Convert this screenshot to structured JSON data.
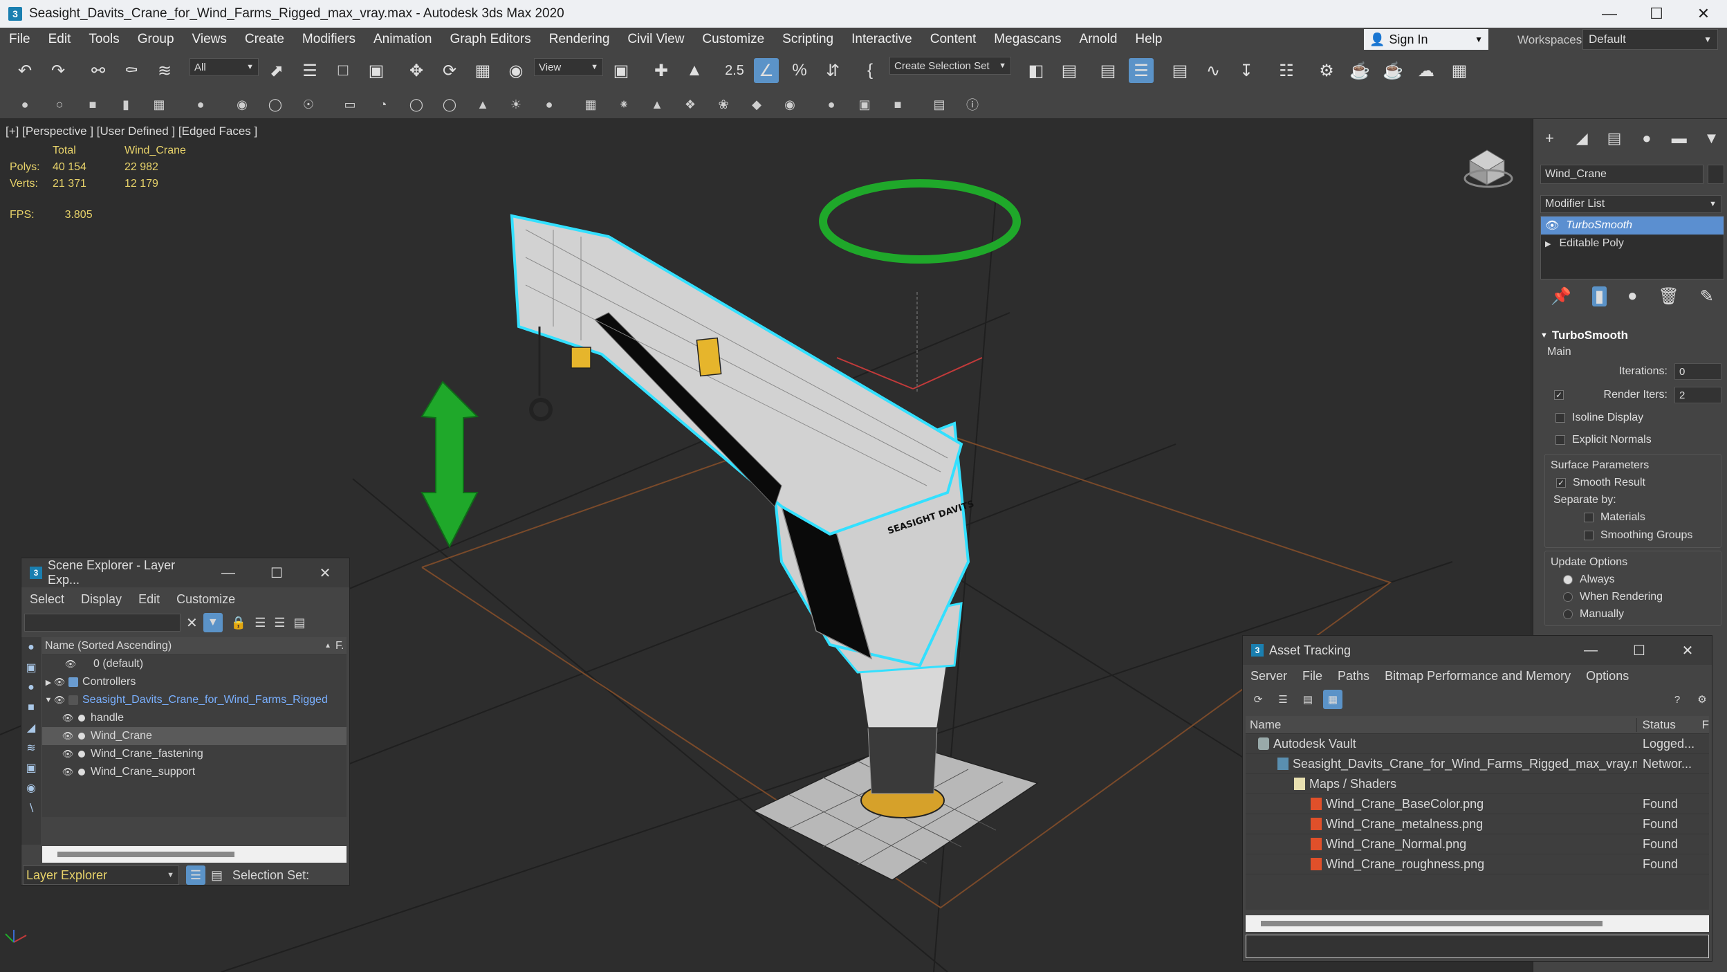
{
  "window": {
    "title": "Seasight_Davits_Crane_for_Wind_Farms_Rigged_max_vray.max - Autodesk 3ds Max 2020",
    "app_icon": "3"
  },
  "menu": [
    "File",
    "Edit",
    "Tools",
    "Group",
    "Views",
    "Create",
    "Modifiers",
    "Animation",
    "Graph Editors",
    "Rendering",
    "Civil View",
    "Customize",
    "Scripting",
    "Interactive",
    "Content",
    "Megascans",
    "Arnold",
    "Help"
  ],
  "account": {
    "sign_in": "Sign In",
    "workspaces_label": "Workspaces:",
    "workspace_value": "Default"
  },
  "toolbar": {
    "filter_value": "All",
    "view_value": "View",
    "selection_set_value": "Create Selection Set",
    "snap_label": "2.5"
  },
  "viewport": {
    "label": "[+] [Perspective ] [User Defined ] [Edged Faces ]",
    "stats_header_total": "Total",
    "stats_header_object": "Wind_Crane",
    "polys_label": "Polys:",
    "polys_total": "40 154",
    "polys_object": "22 982",
    "verts_label": "Verts:",
    "verts_total": "21 371",
    "verts_object": "12 179",
    "fps_label": "FPS:",
    "fps_value": "3.805",
    "sign_text": "SEASIGHT DAVITS"
  },
  "command_panel": {
    "object_name": "Wind_Crane",
    "modifier_list": "Modifier List",
    "stack": [
      "TurboSmooth",
      "Editable Poly"
    ],
    "rollout_title": "TurboSmooth",
    "main_label": "Main",
    "iterations_label": "Iterations:",
    "iterations_value": "0",
    "render_iters_label": "Render Iters:",
    "render_iters_value": "2",
    "isoline_display": "Isoline Display",
    "explicit_normals": "Explicit Normals",
    "surface_parameters": "Surface Parameters",
    "smooth_result": "Smooth Result",
    "separate_by": "Separate by:",
    "materials": "Materials",
    "smoothing_groups": "Smoothing Groups",
    "update_options": "Update Options",
    "always": "Always",
    "when_rendering": "When Rendering",
    "manually": "Manually"
  },
  "scene_explorer": {
    "title": "Scene Explorer - Layer Exp...",
    "menu": [
      "Select",
      "Display",
      "Edit",
      "Customize"
    ],
    "column_name": "Name (Sorted Ascending)",
    "column_f": "F.",
    "rows": [
      {
        "name": "0 (default)"
      },
      {
        "name": "Controllers"
      },
      {
        "name": "Seasight_Davits_Crane_for_Wind_Farms_Rigged"
      },
      {
        "name": "handle"
      },
      {
        "name": "Wind_Crane"
      },
      {
        "name": "Wind_Crane_fastening"
      },
      {
        "name": "Wind_Crane_support"
      }
    ],
    "footer_layer": "Layer Explorer",
    "footer_selection": "Selection Set:"
  },
  "asset_tracking": {
    "title": "Asset Tracking",
    "menu": [
      "Server",
      "File",
      "Paths",
      "Bitmap Performance and Memory",
      "Options"
    ],
    "col_name": "Name",
    "col_status": "Status",
    "col_extra": "F",
    "rows": [
      {
        "name": "Autodesk Vault",
        "status": "Logged..."
      },
      {
        "name": "Seasight_Davits_Crane_for_Wind_Farms_Rigged_max_vray.max",
        "status": "Networ..."
      },
      {
        "name": "Maps / Shaders",
        "status": ""
      },
      {
        "name": "Wind_Crane_BaseColor.png",
        "status": "Found"
      },
      {
        "name": "Wind_Crane_metalness.png",
        "status": "Found"
      },
      {
        "name": "Wind_Crane_Normal.png",
        "status": "Found"
      },
      {
        "name": "Wind_Crane_roughness.png",
        "status": "Found"
      }
    ]
  },
  "colors": {
    "accent": "#5b93c8",
    "selection_outline": "#33e0ff",
    "gizmo_green": "#1fa82a",
    "stats_yellow": "#e8d36a"
  }
}
